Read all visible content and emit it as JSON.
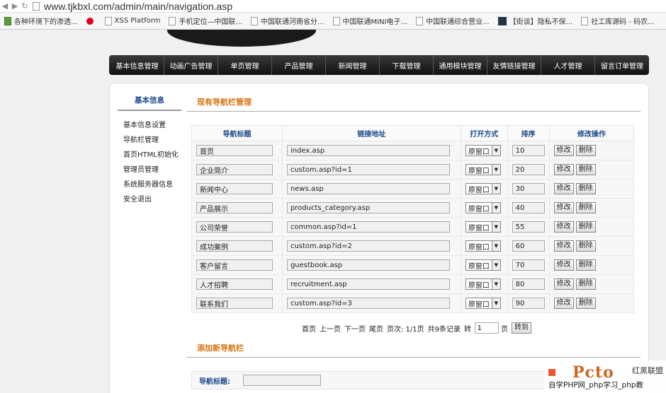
{
  "browser": {
    "url": "www.tjkbxl.com/admin/main/navigation.asp",
    "bookmarks": [
      {
        "label": "各种环境下的渗透...",
        "icon": "green-doc-icon"
      },
      {
        "label": "",
        "icon": "huawei-icon"
      },
      {
        "label": "XSS Platform",
        "icon": "page-icon"
      },
      {
        "label": "手机定位—中国联...",
        "icon": "page-icon"
      },
      {
        "label": "中国联通河南省分...",
        "icon": "page-icon"
      },
      {
        "label": "中国联通MINI电子...",
        "icon": "page-icon"
      },
      {
        "label": "中国联通综合营业...",
        "icon": "page-icon"
      },
      {
        "label": "【街谈】隐私不保...",
        "icon": "blue-n-icon"
      },
      {
        "label": "社工库源码 - 码农...",
        "icon": "page-icon"
      }
    ]
  },
  "topmenu": [
    "基本信息管理",
    "动画广告管理",
    "单页管理",
    "产品管理",
    "新闻管理",
    "下载管理",
    "通用模块管理",
    "友情链接管理",
    "人才管理",
    "留言订单管理"
  ],
  "sidebar": {
    "title": "基本信息",
    "items": [
      "基本信息设置",
      "导航栏管理",
      "首页HTML初始化",
      "管理员管理",
      "系统服务器信息",
      "安全退出"
    ]
  },
  "section": {
    "current": "现有导航栏管理",
    "add": "添加新导航栏"
  },
  "table": {
    "headers": [
      "导航标题",
      "链接地址",
      "打开方式",
      "排序",
      "修改操作"
    ],
    "rows": [
      {
        "title": "首页",
        "url": "index.asp",
        "mode": "原窗口",
        "order": "10"
      },
      {
        "title": "企业简介",
        "url": "custom.asp?id=1",
        "mode": "原窗口",
        "order": "20"
      },
      {
        "title": "新闻中心",
        "url": "news.asp",
        "mode": "原窗口",
        "order": "30"
      },
      {
        "title": "产品展示",
        "url": "products_category.asp",
        "mode": "原窗口",
        "order": "40"
      },
      {
        "title": "公司荣誉",
        "url": "common.asp?id=1",
        "mode": "原窗口",
        "order": "55"
      },
      {
        "title": "成功案例",
        "url": "custom.asp?id=2",
        "mode": "原窗口",
        "order": "60"
      },
      {
        "title": "客户留言",
        "url": "guestbook.asp",
        "mode": "原窗口",
        "order": "70"
      },
      {
        "title": "人才招聘",
        "url": "recruitment.asp",
        "mode": "原窗口",
        "order": "80"
      },
      {
        "title": "联系我们",
        "url": "custom.asp?id=3",
        "mode": "原窗口",
        "order": "90"
      }
    ],
    "edit_label": "修改",
    "delete_label": "删除"
  },
  "pager": {
    "first": "首页",
    "prev": "上一页",
    "next": "下一页",
    "last": "尾页",
    "page_info": "页次: 1/1页",
    "total": "共9条记录",
    "goto_prefix": "转",
    "goto_value": "1",
    "goto_suffix": "页",
    "goto_button": "转到"
  },
  "addform": {
    "title_label": "导航标题:"
  },
  "watermark": {
    "logo": "Pcto",
    "top": "红黑联盟",
    "bottom": "自学PHP网_php学习_php教"
  }
}
